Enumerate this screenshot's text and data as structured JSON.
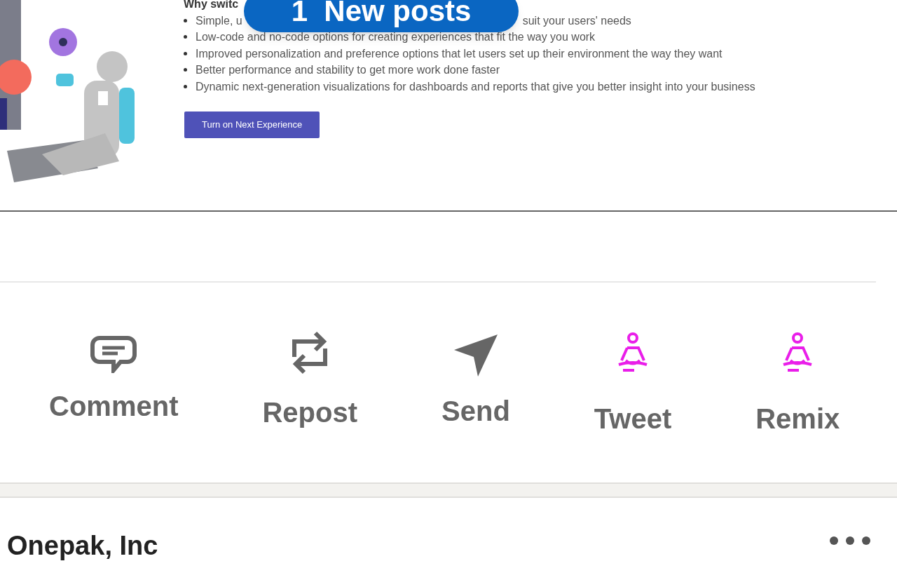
{
  "document": {
    "heading": "Why switc",
    "bullets": [
      {
        "before": "Simple, u",
        "after": "suit your users' needs"
      },
      {
        "before": "Low-code and no-code options for creating experiences that fit the way you work"
      },
      {
        "before": "Improved personalization and preference options that let users set up their environment the way they want"
      },
      {
        "before": "Better performance and stability to get more work done faster"
      },
      {
        "before": "Dynamic next-generation visualizations for dashboards and reports that give you better insight into your business"
      }
    ],
    "button": "Turn on Next Experience"
  },
  "new_posts_pill": "1  New posts",
  "actions": [
    {
      "kind": "comment",
      "label": "Comment"
    },
    {
      "kind": "repost",
      "label": "Repost"
    },
    {
      "kind": "send",
      "label": "Send"
    },
    {
      "kind": "meditate",
      "label": "Tweet"
    },
    {
      "kind": "meditate",
      "label": "Remix"
    }
  ],
  "next_post": {
    "author": "Onepak, Inc"
  }
}
